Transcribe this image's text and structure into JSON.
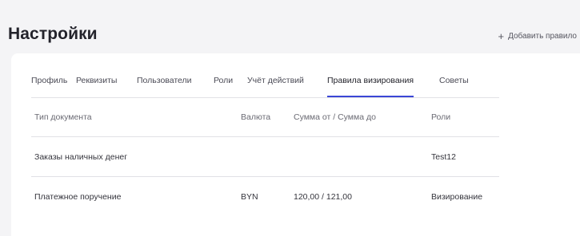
{
  "header": {
    "title": "Настройки",
    "add_rule_label": "Добавить правило",
    "add_rule_icon": "plus-icon",
    "add_rule_glyph": "+"
  },
  "tabs": [
    {
      "label": "Профиль",
      "active": false
    },
    {
      "label": "Реквизиты",
      "active": false
    },
    {
      "label": "Пользователи",
      "active": false
    },
    {
      "label": "Роли",
      "active": false
    },
    {
      "label": "Учёт действий",
      "active": false
    },
    {
      "label": "Правила визирования",
      "active": true
    },
    {
      "label": "Советы",
      "active": false
    }
  ],
  "table": {
    "columns": [
      "Тип документа",
      "Валюта",
      "Сумма от / Сумма до",
      "Роли"
    ],
    "rows": [
      [
        "Заказы наличных денег",
        "",
        "",
        "Test12"
      ],
      [
        "Платежное поручение",
        "BYN",
        "120,00 / 121,00",
        "Визирование"
      ]
    ]
  },
  "colors": {
    "accent": "#3a46d6",
    "background": "#f4f4f6",
    "card": "#ffffff",
    "divider": "#e1e1e6"
  }
}
